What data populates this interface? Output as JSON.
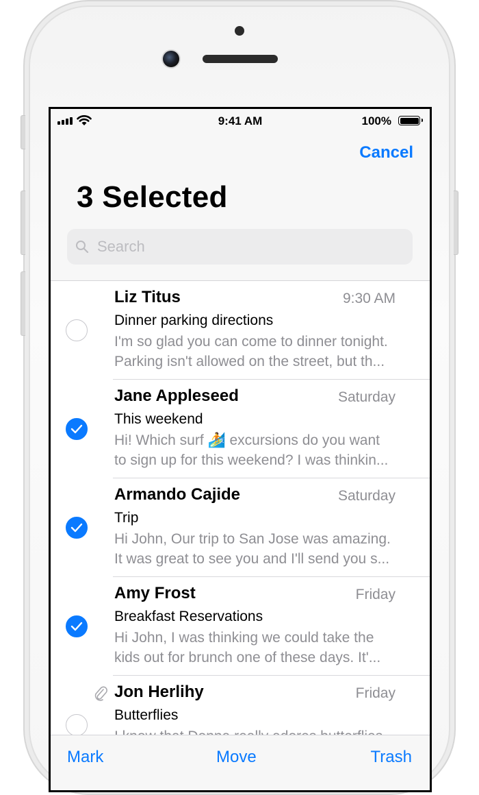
{
  "status_bar": {
    "time": "9:41 AM",
    "battery": "100%"
  },
  "nav": {
    "cancel_label": "Cancel",
    "title": "3 Selected"
  },
  "search": {
    "placeholder": "Search"
  },
  "messages": [
    {
      "sender": "Liz Titus",
      "date": "9:30 AM",
      "subject": "Dinner parking directions",
      "preview1": "I'm so glad you can come to dinner tonight.",
      "preview2": "Parking isn't allowed on the street, but th...",
      "selected": false,
      "attachment": false
    },
    {
      "sender": "Jane Appleseed",
      "date": "Saturday",
      "subject": "This weekend",
      "preview1": "Hi! Which surf 🏄 excursions do you want",
      "preview2": "to sign up for this weekend? I was thinkin...",
      "selected": true,
      "attachment": false
    },
    {
      "sender": "Armando Cajide",
      "date": "Saturday",
      "subject": "Trip",
      "preview1": "Hi John, Our trip to San Jose was amazing.",
      "preview2": "It was great to see you and I'll send you s...",
      "selected": true,
      "attachment": false
    },
    {
      "sender": "Amy Frost",
      "date": "Friday",
      "subject": "Breakfast Reservations",
      "preview1": "Hi John, I was thinking we could take the",
      "preview2": "kids out for brunch one of these days. It'...",
      "selected": true,
      "attachment": false
    },
    {
      "sender": "Jon Herlihy",
      "date": "Friday",
      "subject": "Butterflies",
      "preview1": "I know that Donna really adores butterflies",
      "preview2": "",
      "selected": false,
      "attachment": true
    }
  ],
  "toolbar": {
    "mark_label": "Mark",
    "move_label": "Move",
    "trash_label": "Trash"
  },
  "colors": {
    "accent": "#0a7aff",
    "secondary_text": "#8e8e93",
    "separator": "#d8d8dc"
  },
  "icons": [
    "cellular-signal-icon",
    "wifi-icon",
    "battery-icon",
    "search-icon",
    "checkmark-icon",
    "paperclip-icon"
  ]
}
